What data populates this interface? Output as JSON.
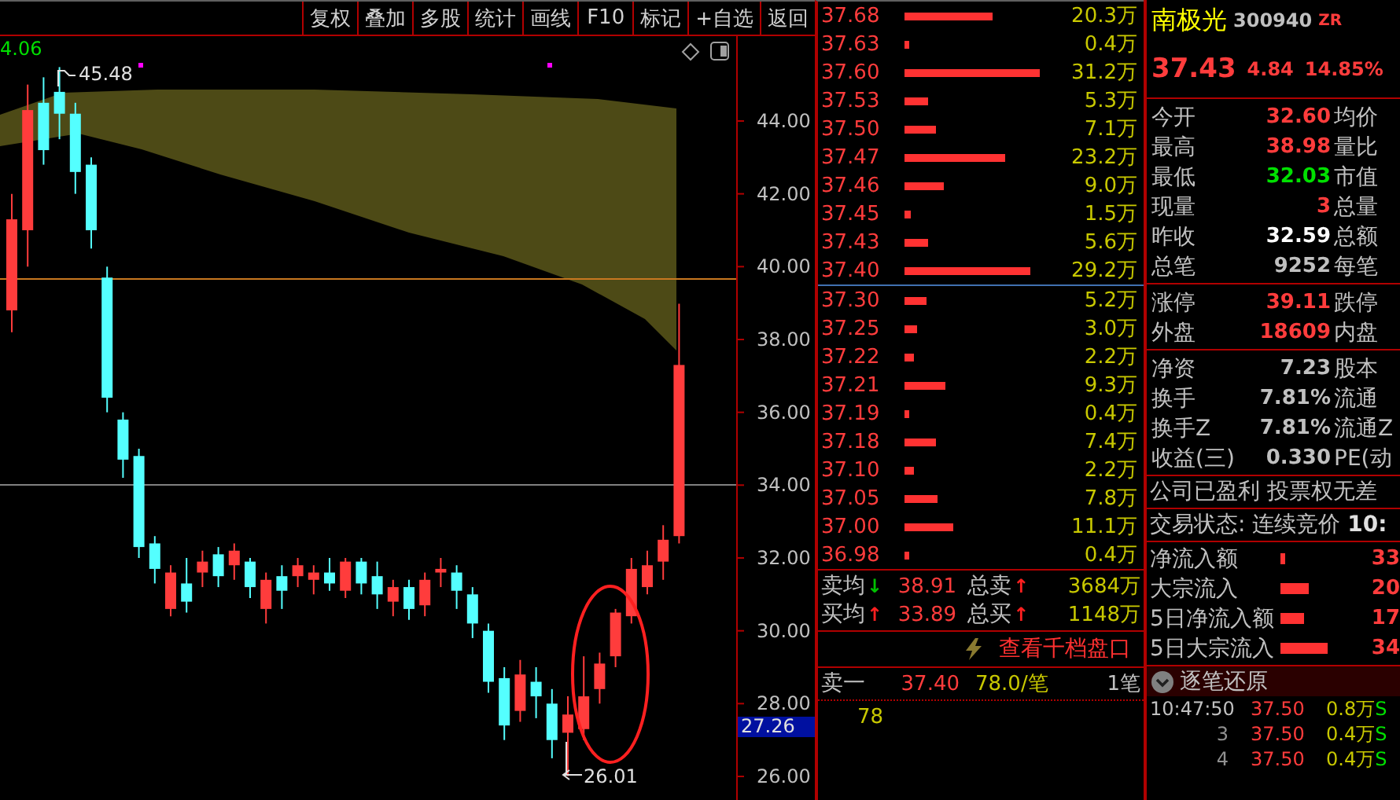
{
  "toolbar": {
    "buttons": [
      "复权",
      "叠加",
      "多股",
      "统计",
      "画线",
      "F10",
      "标记",
      "+自选",
      "返回"
    ]
  },
  "chart": {
    "corner_value": "4.06",
    "high_label": "45.48",
    "low_label": "26.01",
    "price_tag": "27.26",
    "chart_data": {
      "type": "candlestick",
      "ylim": [
        25.31,
        46.33
      ],
      "yticks": [
        {
          "value": 44,
          "label": "44.00"
        },
        {
          "value": 42,
          "label": "42.00"
        },
        {
          "value": 40,
          "label": "40.00"
        },
        {
          "value": 38,
          "label": "38.00"
        },
        {
          "value": 36,
          "label": "36.00"
        },
        {
          "value": 34,
          "label": "34.00"
        },
        {
          "value": 32,
          "label": "32.00"
        },
        {
          "value": 30,
          "label": "30.00"
        },
        {
          "value": 28,
          "label": "28.00"
        },
        {
          "value": 26,
          "label": "26.00"
        }
      ],
      "ohlc": [
        [
          38.8,
          42.0,
          38.2,
          41.3
        ],
        [
          41.0,
          45.0,
          40.0,
          44.3
        ],
        [
          44.5,
          45.2,
          42.8,
          43.2
        ],
        [
          44.8,
          45.48,
          43.5,
          44.2
        ],
        [
          44.2,
          44.5,
          42.0,
          42.6
        ],
        [
          42.8,
          43.0,
          40.5,
          41.0
        ],
        [
          39.7,
          40.0,
          36.0,
          36.4
        ],
        [
          35.8,
          36.0,
          34.2,
          34.7
        ],
        [
          34.8,
          35.0,
          32.0,
          32.3
        ],
        [
          32.4,
          32.6,
          31.3,
          31.7
        ],
        [
          30.6,
          31.8,
          30.4,
          31.6
        ],
        [
          31.3,
          32.0,
          30.5,
          30.8
        ],
        [
          31.6,
          32.2,
          31.2,
          31.9
        ],
        [
          32.1,
          32.3,
          31.2,
          31.5
        ],
        [
          31.8,
          32.4,
          31.4,
          32.2
        ],
        [
          31.9,
          32.0,
          30.9,
          31.2
        ],
        [
          30.6,
          31.6,
          30.2,
          31.4
        ],
        [
          31.5,
          31.8,
          30.6,
          31.1
        ],
        [
          31.5,
          32.0,
          31.2,
          31.8
        ],
        [
          31.4,
          31.8,
          31.0,
          31.6
        ],
        [
          31.6,
          32.0,
          31.1,
          31.3
        ],
        [
          31.1,
          32.0,
          30.9,
          31.9
        ],
        [
          31.9,
          32.0,
          31.0,
          31.3
        ],
        [
          31.5,
          31.9,
          30.6,
          31.0
        ],
        [
          30.8,
          31.4,
          30.4,
          31.2
        ],
        [
          31.2,
          31.4,
          30.3,
          30.6
        ],
        [
          30.7,
          31.6,
          30.4,
          31.4
        ],
        [
          31.6,
          32.0,
          31.2,
          31.7
        ],
        [
          31.6,
          31.8,
          30.6,
          31.1
        ],
        [
          31.0,
          31.2,
          29.8,
          30.2
        ],
        [
          30.0,
          30.2,
          28.3,
          28.6
        ],
        [
          28.7,
          29.0,
          27.0,
          27.4
        ],
        [
          27.8,
          29.2,
          27.5,
          28.8
        ],
        [
          28.6,
          29.0,
          27.6,
          28.2
        ],
        [
          28.0,
          28.4,
          26.5,
          27.0
        ],
        [
          27.2,
          28.2,
          26.01,
          27.7
        ],
        [
          27.3,
          29.3,
          27.0,
          28.2
        ],
        [
          28.4,
          29.4,
          28.0,
          29.1
        ],
        [
          29.3,
          30.6,
          29.0,
          30.5
        ],
        [
          30.4,
          32.0,
          30.2,
          31.7
        ],
        [
          31.2,
          32.2,
          31.0,
          31.8
        ],
        [
          31.9,
          32.9,
          31.4,
          32.5
        ],
        [
          32.6,
          38.98,
          32.4,
          37.3
        ]
      ]
    }
  },
  "order_book": {
    "asks": [
      {
        "price": "37.68",
        "volume": "20.3万"
      },
      {
        "price": "37.63",
        "volume": "0.4万"
      },
      {
        "price": "37.60",
        "volume": "31.2万"
      },
      {
        "price": "37.53",
        "volume": "5.3万"
      },
      {
        "price": "37.50",
        "volume": "7.1万"
      },
      {
        "price": "37.47",
        "volume": "23.2万"
      },
      {
        "price": "37.46",
        "volume": "9.0万"
      },
      {
        "price": "37.45",
        "volume": "1.5万"
      },
      {
        "price": "37.43",
        "volume": "5.6万"
      },
      {
        "price": "37.40",
        "volume": "29.2万"
      }
    ],
    "bids": [
      {
        "price": "37.30",
        "volume": "5.2万"
      },
      {
        "price": "37.25",
        "volume": "3.0万"
      },
      {
        "price": "37.22",
        "volume": "2.2万"
      },
      {
        "price": "37.21",
        "volume": "9.3万"
      },
      {
        "price": "37.19",
        "volume": "0.4万"
      },
      {
        "price": "37.18",
        "volume": "7.4万"
      },
      {
        "price": "37.10",
        "volume": "2.2万"
      },
      {
        "price": "37.05",
        "volume": "7.8万"
      },
      {
        "price": "37.00",
        "volume": "11.1万"
      },
      {
        "price": "36.98",
        "volume": "0.4万"
      }
    ]
  },
  "summary": [
    {
      "items": [
        {
          "label": "卖均",
          "arrow": "↓",
          "color": "#00c000",
          "value": "38.91"
        },
        {
          "label": "总卖",
          "arrow": "↑",
          "color": "#ff2020",
          "value": "3684万"
        }
      ]
    },
    {
      "items": [
        {
          "label": "买均",
          "arrow": "↑",
          "color": "#ff2020",
          "value": "33.89"
        },
        {
          "label": "总买",
          "arrow": "↑",
          "color": "#ff2020",
          "value": "1148万"
        }
      ]
    }
  ],
  "depth_link": "查看千档盘口",
  "sell_one": {
    "label": "卖一",
    "price": "37.40",
    "volume": "78.0/笔",
    "count": "1笔",
    "detail": "78"
  },
  "quote": {
    "name": "南极光",
    "code": "300940",
    "tag": "ZR",
    "price": "37.43",
    "change": "4.84",
    "change_pct": "14.85%"
  },
  "stat_groups": [
    [
      {
        "label": "今开",
        "value": "32.60",
        "color": "#ff3c3c",
        "label_2": "均价"
      },
      {
        "label": "最高",
        "value": "38.98",
        "color": "#ff3c3c",
        "label_2": "量比"
      },
      {
        "label": "最低",
        "value": "32.03",
        "color": "#00e000",
        "label_2": "市值"
      },
      {
        "label": "现量",
        "value": "3",
        "color": "#ff3c3c",
        "label_2": "总量"
      },
      {
        "label": "昨收",
        "value": "32.59",
        "color": "#ffffff",
        "label_2": "总额"
      },
      {
        "label": "总笔",
        "value": "9252",
        "color": "#c0c0c0",
        "label_2": "每笔"
      }
    ],
    [
      {
        "label": "涨停",
        "value": "39.11",
        "color": "#ff3c3c",
        "label_2": "跌停"
      },
      {
        "label": "外盘",
        "value": "18609",
        "color": "#ff3c3c",
        "label_2": "内盘"
      }
    ],
    [
      {
        "label": "净资",
        "value": "7.23",
        "color": "#c0c0c0",
        "label_2": "股本"
      },
      {
        "label": "换手",
        "value": "7.81%",
        "color": "#c0c0c0",
        "label_2": "流通"
      },
      {
        "label": "换手Z",
        "value": "7.81%",
        "color": "#c0c0c0",
        "label_2": "流通Z"
      },
      {
        "label": "收益(三)",
        "value": "0.330",
        "color": "#c0c0c0",
        "label_2": "PE(动"
      }
    ]
  ],
  "notice": "公司已盈利 投票权无差",
  "trade_status": "交易状态: 连续竞价 **10:**",
  "flows": [
    {
      "label": "净流入额",
      "value": "33"
    },
    {
      "label": "大宗流入",
      "value": "20"
    },
    {
      "label": "5日净流入额",
      "value": "17"
    },
    {
      "label": "5日大宗流入",
      "value": "34"
    }
  ],
  "ticks_header": {
    "title": "逐笔还原",
    "expanded": true
  },
  "ticks": [
    {
      "time": "10:47:50",
      "price": "37.50",
      "volume": "0.8万",
      "side": "S"
    },
    {
      "time": "3",
      "price": "37.50",
      "volume": "0.4万",
      "side": "S"
    },
    {
      "time": "4",
      "price": "37.50",
      "volume": "0.4万",
      "side": "S"
    }
  ]
}
